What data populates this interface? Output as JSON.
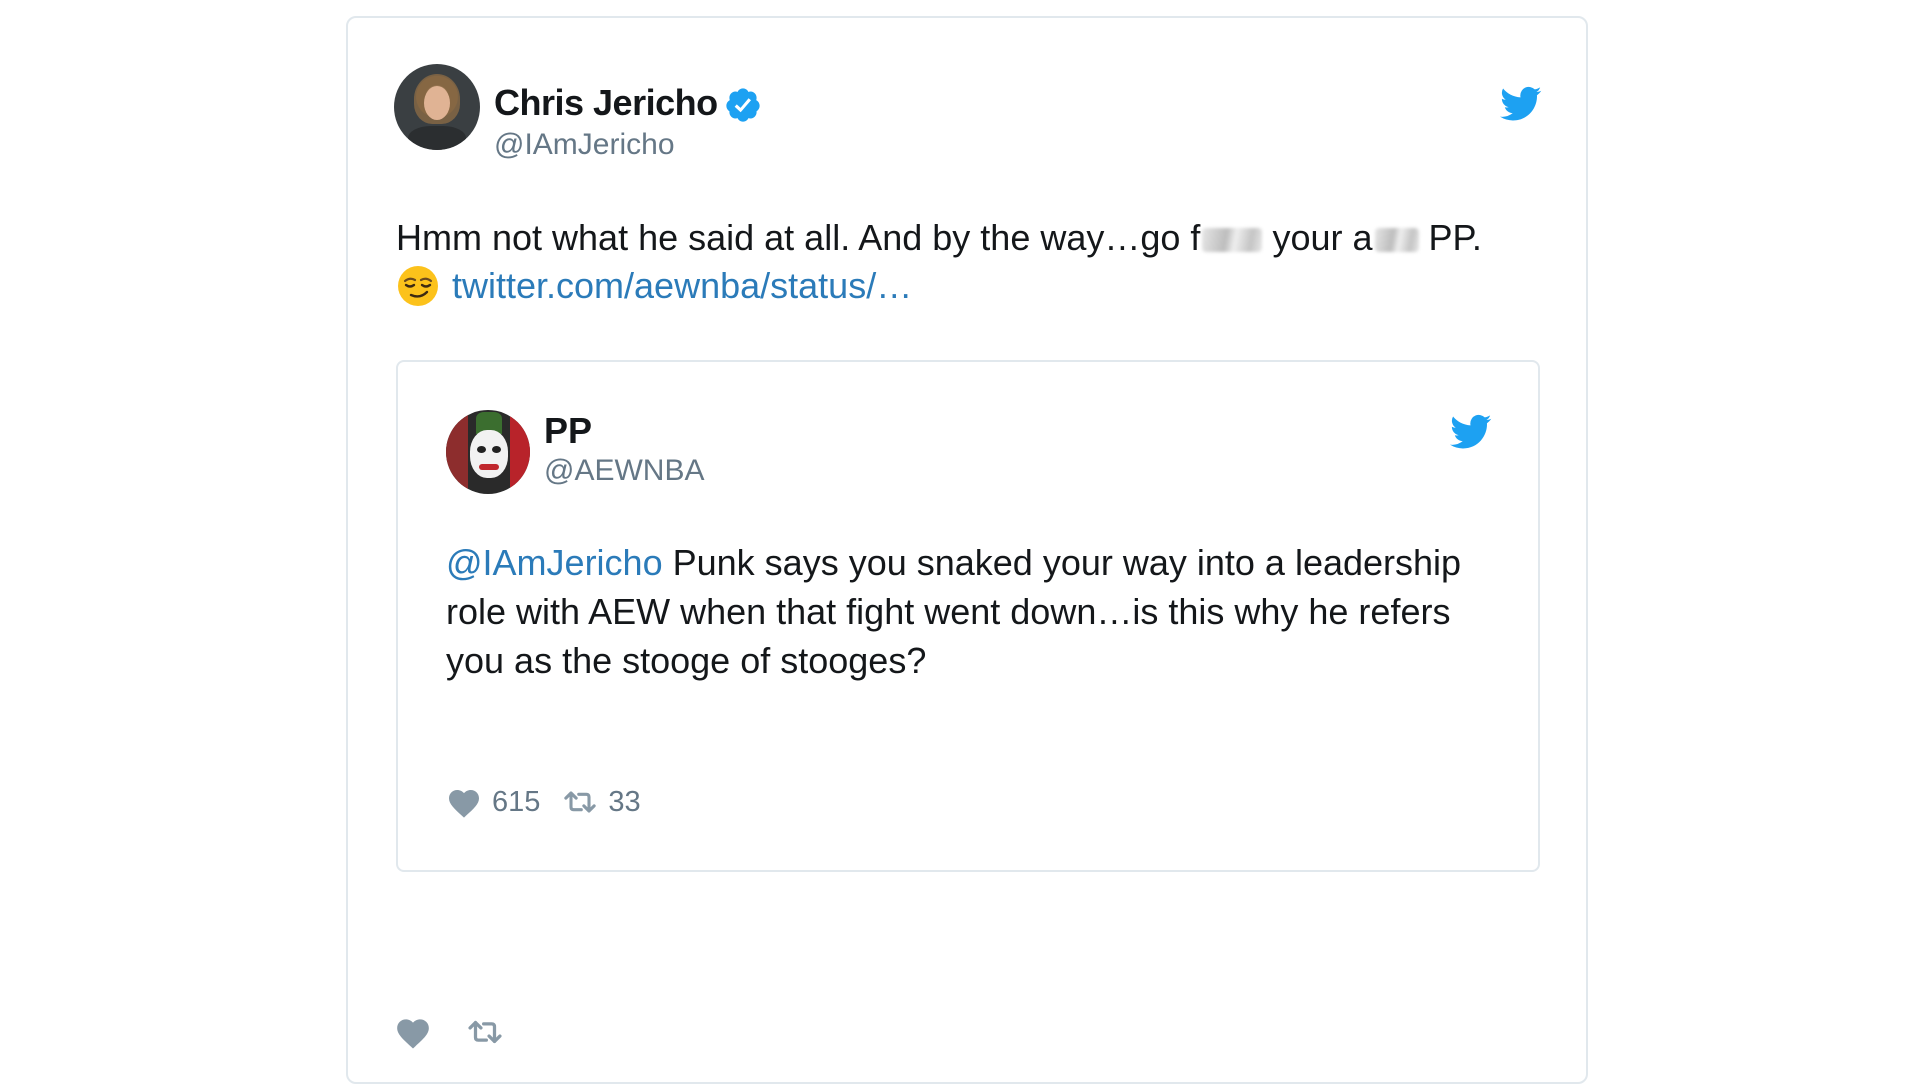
{
  "colors": {
    "brand_blue": "#1da1f2",
    "link_blue": "#2b7bb9",
    "muted_gray": "#657786",
    "icon_gray": "#8899a6",
    "border": "#e1e8ed"
  },
  "tweet": {
    "author": {
      "name": "Chris Jericho",
      "handle": "@IAmJericho",
      "verified": true,
      "verified_icon": "verified-badge-icon"
    },
    "text": {
      "part1": "Hmm not what he said at all. And by the way…go f",
      "part2": "your a",
      "part3": "PP.",
      "emoji": "smirking-face-emoji",
      "link": "twitter.com/aewnba/status/…"
    },
    "platform_icon": "twitter-bird-icon",
    "actions": [
      {
        "icon": "heart-icon"
      },
      {
        "icon": "retweet-icon"
      }
    ]
  },
  "quoted_tweet": {
    "author": {
      "name": "PP",
      "handle": "@AEWNBA"
    },
    "text": {
      "mention": "@IAmJericho",
      "body": " Punk says you snaked your way into a leadership role with AEW when that fight went down…is this why he refers you as the stooge of stooges?"
    },
    "stats": {
      "likes": "615",
      "retweets": "33"
    },
    "platform_icon": "twitter-bird-icon"
  }
}
